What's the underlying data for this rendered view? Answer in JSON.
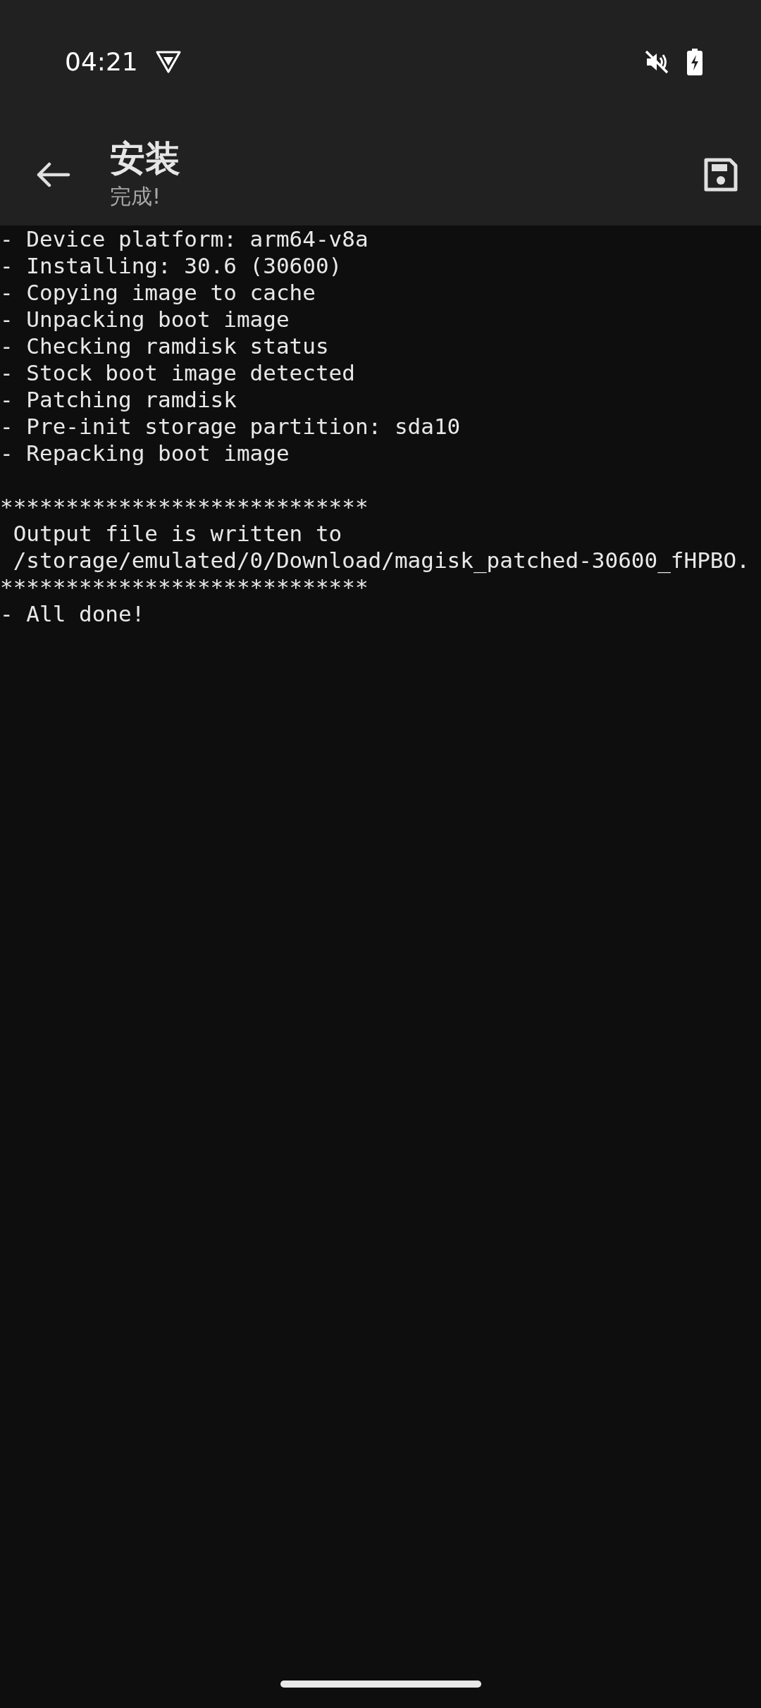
{
  "status_bar": {
    "time": "04:21"
  },
  "app_bar": {
    "title": "安装",
    "subtitle": "完成!"
  },
  "log": {
    "lines": [
      {
        "kind": "text",
        "text": "- Device platform: arm64-v8a"
      },
      {
        "kind": "text",
        "text": "- Installing: 30.6 (30600)"
      },
      {
        "kind": "text",
        "text": "- Copying image to cache"
      },
      {
        "kind": "text",
        "text": "- Unpacking boot image"
      },
      {
        "kind": "text",
        "text": "- Checking ramdisk status"
      },
      {
        "kind": "text",
        "text": "- Stock boot image detected"
      },
      {
        "kind": "text",
        "text": "- Patching ramdisk"
      },
      {
        "kind": "text",
        "text": "- Pre-init storage partition: sda10"
      },
      {
        "kind": "text",
        "text": "- Repacking boot image"
      },
      {
        "kind": "blank"
      },
      {
        "kind": "text",
        "text": "****************************"
      },
      {
        "kind": "text",
        "text": " Output file is written to"
      },
      {
        "kind": "text",
        "text": " /storage/emulated/0/Download/magisk_patched-30600_fHPBO."
      },
      {
        "kind": "text",
        "text": "****************************"
      },
      {
        "kind": "text",
        "text": "- All done!"
      }
    ]
  }
}
